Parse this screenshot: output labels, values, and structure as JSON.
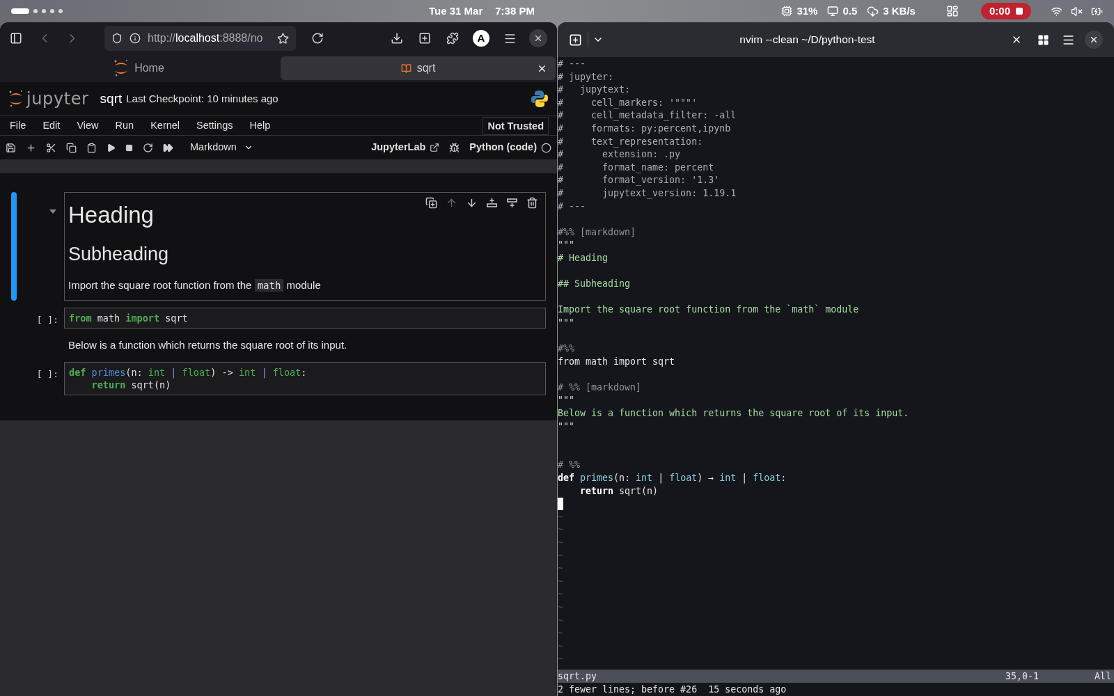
{
  "top_bar": {
    "workspaces": [
      {
        "selected": true
      },
      {
        "selected": false
      },
      {
        "selected": false
      },
      {
        "selected": false
      },
      {
        "selected": false
      }
    ],
    "date": "Tue 31 Mar",
    "time": "7:38 PM",
    "cpu": "31%",
    "load": "0.5",
    "network": "3 KB/s",
    "recording": "0:00"
  },
  "browser": {
    "url": [
      {
        "kind": "dim",
        "text": "http://"
      },
      {
        "kind": "host",
        "text": "localhost"
      },
      {
        "kind": "dim",
        "text": ":8888/no"
      }
    ],
    "avatar": "A",
    "tabs": [
      {
        "label": "Home",
        "selected": false
      },
      {
        "label": "sqrt",
        "selected": true
      }
    ]
  },
  "jupyter": {
    "logo_text": "jupyter",
    "notebook_name": "sqrt",
    "checkpoint": "Last Checkpoint: 10 minutes ago",
    "menu": [
      "File",
      "Edit",
      "View",
      "Run",
      "Kernel",
      "Settings",
      "Help"
    ],
    "trust": "Not Trusted",
    "cell_type": "Markdown",
    "lab_link": "JupyterLab",
    "kernel": "Python (code)",
    "cells": [
      {
        "kind": "markdown",
        "selected": true,
        "blocks": [
          {
            "kind": "h1",
            "parts": [
              {
                "kind": "text",
                "text": "Heading"
              }
            ]
          },
          {
            "kind": "h2",
            "parts": [
              {
                "kind": "text",
                "text": "Subheading"
              }
            ]
          },
          {
            "kind": "p",
            "parts": [
              {
                "kind": "text",
                "text": "Import the square root function from the "
              },
              {
                "kind": "code",
                "text": "math"
              },
              {
                "kind": "text",
                "text": " module"
              }
            ]
          }
        ]
      },
      {
        "kind": "code",
        "selected": false,
        "prompt": "[ ]:",
        "lines": [
          [
            {
              "kind": "keyword",
              "text": "from"
            },
            {
              "kind": "plain",
              "text": " math "
            },
            {
              "kind": "keyword",
              "text": "import"
            },
            {
              "kind": "plain",
              "text": " sqrt"
            }
          ]
        ]
      },
      {
        "kind": "markdown",
        "selected": false,
        "blocks": [
          {
            "kind": "p",
            "parts": [
              {
                "kind": "text",
                "text": "Below is a function which returns the square root of its input."
              }
            ]
          }
        ]
      },
      {
        "kind": "code",
        "selected": false,
        "prompt": "[ ]:",
        "lines": [
          [
            {
              "kind": "keyword",
              "text": "def"
            },
            {
              "kind": "func",
              "text": " primes"
            },
            {
              "kind": "plain",
              "text": "(n: "
            },
            {
              "kind": "type",
              "text": "int"
            },
            {
              "kind": "op",
              "text": " |"
            },
            {
              "kind": "type",
              "text": " float"
            },
            {
              "kind": "plain",
              "text": ") -> "
            },
            {
              "kind": "type",
              "text": "int"
            },
            {
              "kind": "op",
              "text": " |"
            },
            {
              "kind": "type",
              "text": " float"
            },
            {
              "kind": "plain",
              "text": ":"
            }
          ],
          [
            {
              "kind": "keyword",
              "text": "    return"
            },
            {
              "kind": "plain",
              "text": " sqrt(n)"
            }
          ]
        ]
      }
    ]
  },
  "terminal": {
    "title": "nvim --clean ~/D/python-test",
    "lines": [
      [
        {
          "kind": "comment",
          "text": "# ---"
        }
      ],
      [
        {
          "kind": "comment",
          "text": "# jupyter:"
        }
      ],
      [
        {
          "kind": "comment",
          "text": "#   jupytext:"
        }
      ],
      [
        {
          "kind": "comment",
          "text": "#     cell_markers: '\"\"\"'"
        }
      ],
      [
        {
          "kind": "comment",
          "text": "#     cell_metadata_filter: -all"
        }
      ],
      [
        {
          "kind": "comment",
          "text": "#     formats: py:percent,ipynb"
        }
      ],
      [
        {
          "kind": "comment",
          "text": "#     text_representation:"
        }
      ],
      [
        {
          "kind": "comment",
          "text": "#       extension: .py"
        }
      ],
      [
        {
          "kind": "comment",
          "text": "#       format_name: percent"
        }
      ],
      [
        {
          "kind": "comment",
          "text": "#       format_version: '1.3'"
        }
      ],
      [
        {
          "kind": "comment",
          "text": "#       jupytext_version: 1.19.1"
        }
      ],
      [
        {
          "kind": "comment",
          "text": "# ---"
        }
      ],
      {
        "kind": "blank"
      },
      [
        {
          "kind": "marker",
          "text": "#%% [markdown]"
        }
      ],
      [
        {
          "kind": "string",
          "text": "\"\"\""
        }
      ],
      [
        {
          "kind": "md",
          "text": "# Heading"
        }
      ],
      {
        "kind": "blank"
      },
      [
        {
          "kind": "md",
          "text": "## Subheading"
        }
      ],
      {
        "kind": "blank"
      },
      [
        {
          "kind": "md",
          "text": "Import the square root function from the `math` module"
        }
      ],
      [
        {
          "kind": "string",
          "text": "\"\"\""
        }
      ],
      {
        "kind": "blank"
      },
      [
        {
          "kind": "marker",
          "text": "#%%"
        }
      ],
      [
        {
          "kind": "plain",
          "text": "from math import sqrt"
        }
      ],
      {
        "kind": "blank"
      },
      [
        {
          "kind": "marker",
          "text": "# %% [markdown]"
        }
      ],
      [
        {
          "kind": "string",
          "text": "\"\"\""
        }
      ],
      [
        {
          "kind": "md",
          "text": "Below is a function which returns the square root of its input."
        }
      ],
      [
        {
          "kind": "string",
          "text": "\"\"\""
        }
      ],
      {
        "kind": "blank"
      },
      {
        "kind": "blank"
      },
      [
        {
          "kind": "marker",
          "text": "# %%"
        }
      ],
      [
        {
          "kind": "keyword",
          "text": "def"
        },
        {
          "kind": "func",
          "text": " primes"
        },
        {
          "kind": "plain",
          "text": "(n: "
        },
        {
          "kind": "func",
          "text": "int"
        },
        {
          "kind": "plain",
          "text": " | "
        },
        {
          "kind": "func",
          "text": "float"
        },
        {
          "kind": "plain",
          "text": ") → "
        },
        {
          "kind": "func",
          "text": "int"
        },
        {
          "kind": "plain",
          "text": " | "
        },
        {
          "kind": "func",
          "text": "float"
        },
        {
          "kind": "plain",
          "text": ":"
        }
      ],
      [
        {
          "kind": "keyword",
          "text": "    return"
        },
        {
          "kind": "plain",
          "text": " sqrt(n)"
        }
      ]
    ],
    "tildes": [
      "~",
      "~",
      "~",
      "~",
      "~",
      "~",
      "~",
      "~",
      "~",
      "~",
      "~",
      "~"
    ],
    "status_file": "sqrt.py",
    "status_position": "35,0-1",
    "status_scroll": "All",
    "message": "2 fewer lines; before #26  15 seconds ago"
  }
}
